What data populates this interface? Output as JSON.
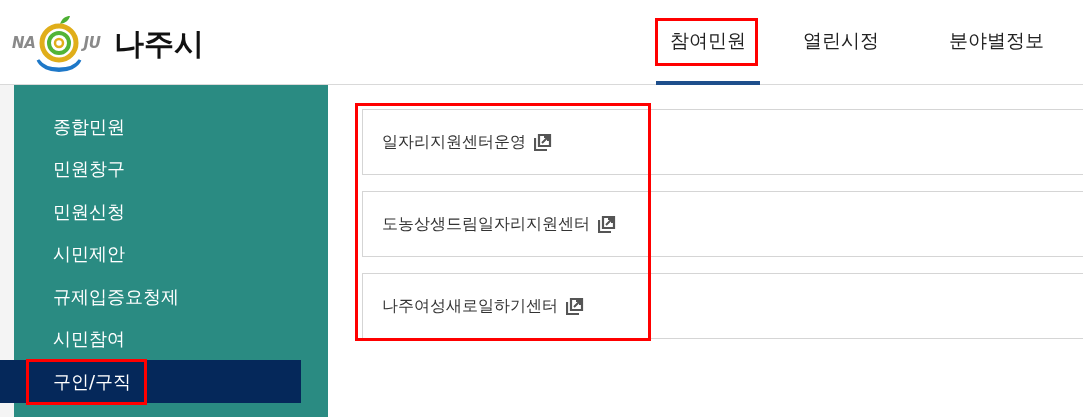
{
  "logo": {
    "left_text": "NA",
    "right_text": "JU",
    "site_name": "나주시"
  },
  "nav": [
    {
      "label": "참여민원",
      "selected": true,
      "highlighted": true
    },
    {
      "label": "열린시정",
      "selected": false,
      "highlighted": false
    },
    {
      "label": "분야별정보",
      "selected": false,
      "highlighted": false
    }
  ],
  "sidebar": [
    {
      "label": "종합민원",
      "selected": false,
      "highlighted": false
    },
    {
      "label": "민원창구",
      "selected": false,
      "highlighted": false
    },
    {
      "label": "민원신청",
      "selected": false,
      "highlighted": false
    },
    {
      "label": "시민제안",
      "selected": false,
      "highlighted": false
    },
    {
      "label": "규제입증요청제",
      "selected": false,
      "highlighted": false
    },
    {
      "label": "시민참여",
      "selected": false,
      "highlighted": false
    },
    {
      "label": "구인/구직",
      "selected": true,
      "highlighted": true
    }
  ],
  "links": {
    "highlighted": true,
    "items": [
      {
        "label": "일자리지원센터운영"
      },
      {
        "label": "도농상생드림일자리지원센터"
      },
      {
        "label": "나주여성새로일하기센터"
      }
    ]
  }
}
